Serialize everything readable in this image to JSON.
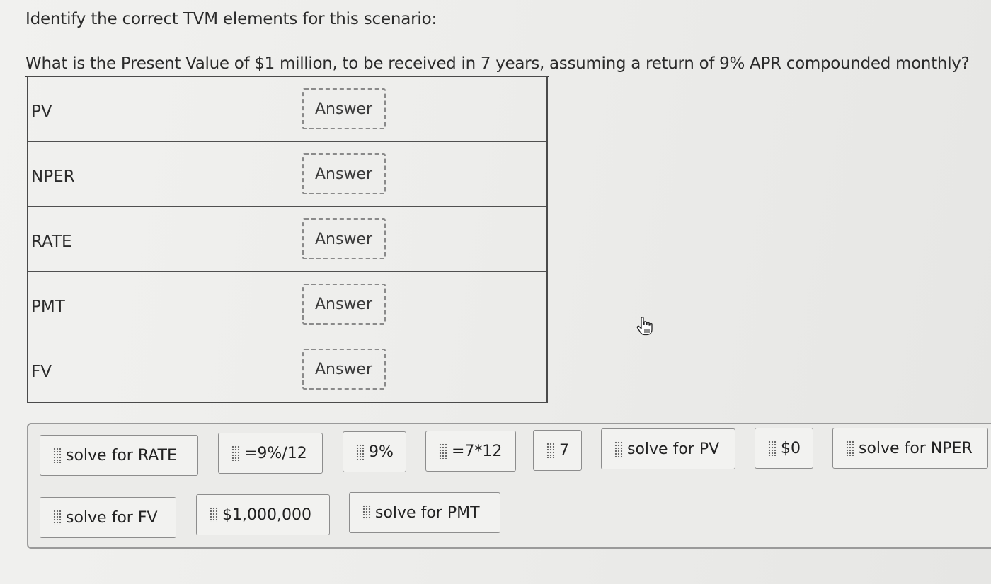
{
  "prompt": {
    "intro": "Identify the correct TVM elements for this scenario:",
    "question": "What is the Present Value of $1 million, to be received in 7 years, assuming a return of 9% APR compounded monthly?"
  },
  "table": {
    "rows": [
      {
        "label": "PV",
        "placeholder": "Answer"
      },
      {
        "label": "NPER",
        "placeholder": "Answer"
      },
      {
        "label": "RATE",
        "placeholder": "Answer"
      },
      {
        "label": "PMT",
        "placeholder": "Answer"
      },
      {
        "label": "FV",
        "placeholder": "Answer"
      }
    ]
  },
  "answer_bank": {
    "chips": [
      "solve for RATE",
      "=9%/12",
      "9%",
      "=7*12",
      "7",
      "solve for PV",
      "$0",
      "solve for NPER",
      "solve for FV",
      "$1,000,000",
      "solve for PMT"
    ]
  },
  "cursor": {
    "icon": "hand-pointer-icon"
  }
}
